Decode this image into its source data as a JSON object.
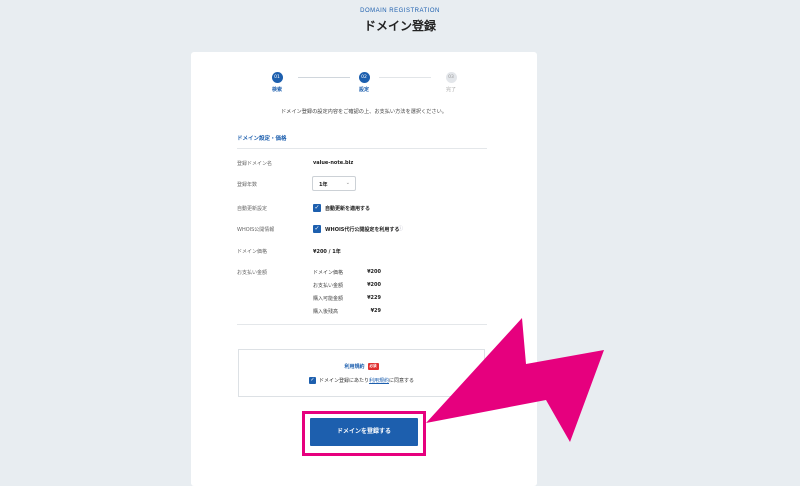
{
  "header": {
    "eyebrow": "DOMAIN REGISTRATION",
    "title": "ドメイン登録"
  },
  "steps": [
    {
      "number": "01",
      "label": "検索",
      "state": "done"
    },
    {
      "number": "02",
      "label": "設定",
      "state": "current"
    },
    {
      "number": "03",
      "label": "完了",
      "state": "upcoming"
    }
  ],
  "intro": "ドメイン登録の設定内容をご確認の上、お支払い方法を選択ください。",
  "section_title": "ドメイン設定・価格",
  "form": {
    "domain_label": "登録ドメイン名",
    "domain_value": "value-note.biz",
    "years_label": "登録年数",
    "years_value": "1年",
    "auto_renew_label": "自動更新設定",
    "auto_renew_checkbox": "自動更新を適用する",
    "whois_label": "WHOIS公開情報",
    "whois_checkbox": "WHOIS代行公開設定を利用する",
    "price_label": "ドメイン価格",
    "price_value": "¥200 / 1年",
    "payment_label": "お支払い金額",
    "payment_rows": [
      {
        "label": "ドメイン価格",
        "value": "¥200"
      },
      {
        "label": "お支払い金額",
        "value": "¥200"
      },
      {
        "label": "購入可能金額",
        "value": "¥229"
      },
      {
        "label": "購入後残高",
        "value": "¥29"
      }
    ]
  },
  "terms": {
    "title": "利用規約",
    "required_badge": "必須",
    "agree_prefix": "ドメイン登録にあたり",
    "agree_link": "利用規約",
    "agree_suffix": "に同意する"
  },
  "submit_label": "ドメインを登録する",
  "colors": {
    "accent": "#1d5fae",
    "highlight": "#e6007e",
    "background": "#e8edf1"
  },
  "icons": {
    "check": "check-icon",
    "chevron": "chevron-down-icon",
    "info": "info-icon",
    "annotation_arrow": "pointer-arrow-icon"
  }
}
